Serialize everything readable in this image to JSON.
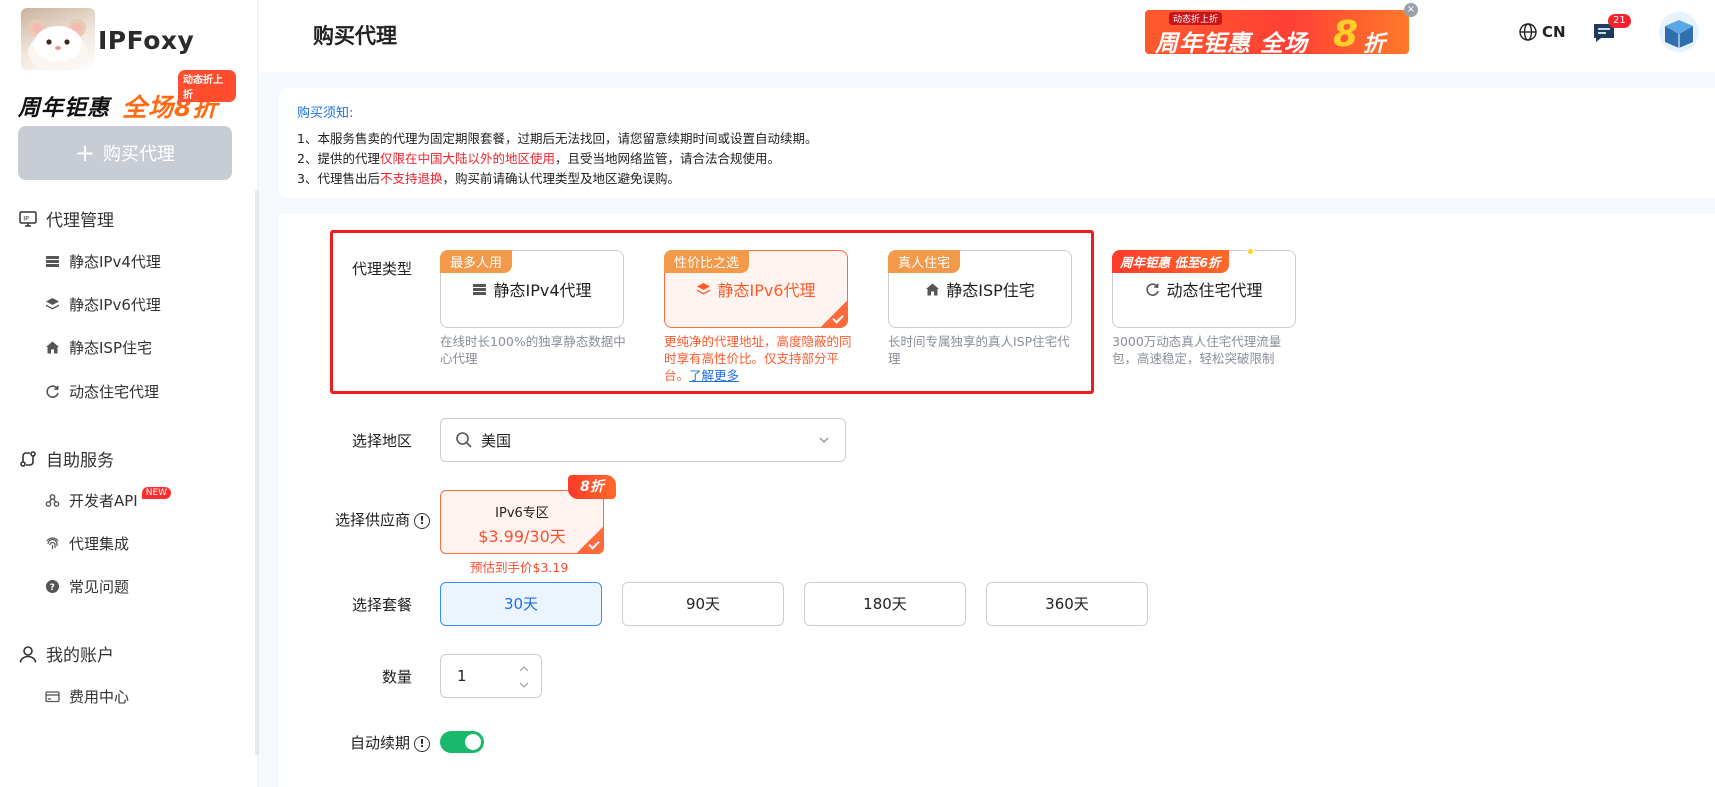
{
  "brand": {
    "name": "IPFoxy"
  },
  "sidebar_promo": {
    "text_black": "周年钜惠",
    "text_orange": "全场8折",
    "tag": "动态折上折"
  },
  "buy_button": {
    "label": "购买代理"
  },
  "nav": {
    "proxy_management": {
      "label": "代理管理",
      "items": [
        {
          "label": "静态IPv4代理",
          "icon": "server-icon"
        },
        {
          "label": "静态IPv6代理",
          "icon": "layers-icon"
        },
        {
          "label": "静态ISP住宅",
          "icon": "home-icon"
        },
        {
          "label": "动态住宅代理",
          "icon": "refresh-icon"
        }
      ]
    },
    "self_service": {
      "label": "自助服务",
      "items": [
        {
          "label": "开发者API",
          "badge": "NEW",
          "icon": "api-icon"
        },
        {
          "label": "代理集成",
          "icon": "fingerprint-icon"
        },
        {
          "label": "常见问题",
          "icon": "question-icon"
        }
      ]
    },
    "my_account": {
      "label": "我的账户",
      "items": [
        {
          "label": "费用中心",
          "icon": "card-icon"
        }
      ]
    }
  },
  "header": {
    "title": "购买代理",
    "banner": {
      "tag": "动态折上折",
      "text": "周年钜惠 全场",
      "number": "8",
      "suffix": "折"
    },
    "banner_close": "×",
    "language": "CN",
    "message_count": "21"
  },
  "notice": {
    "title": "购买须知:",
    "line1": "1、本服务售卖的代理为固定期限套餐，过期后无法找回，请您留意续期时间或设置自动续期。",
    "line2_prefix": "2、提供的代理",
    "line2_red": "仅限在中国大陆以外的地区使用",
    "line2_suffix": "，且受当地网络监管，请合法合规使用。",
    "line3_prefix": "3、代理售出后",
    "line3_red": "不支持退换",
    "line3_suffix": "，购买前请确认代理类型及地区避免误购。"
  },
  "form": {
    "proxy_type_label": "代理类型",
    "proxy_types": [
      {
        "tag": "最多人用",
        "label": "静态IPv4代理",
        "desc": "在线时长100%的独享静态数据中心代理"
      },
      {
        "tag": "性价比之选",
        "label": "静态IPv6代理",
        "desc": "更纯净的代理地址，高度隐蔽的同时享有高性价比。仅支持部分平台。",
        "learn_more": "了解更多",
        "selected": true
      },
      {
        "tag": "真人住宅",
        "label": "静态ISP住宅",
        "desc": "长时间专属独享的真人ISP住宅代理"
      },
      {
        "tag": "周年钜惠 低至6折",
        "label": "动态住宅代理",
        "desc": "3000万动态真人住宅代理流量包，高速稳定，轻松突破限制"
      }
    ],
    "region_label": "选择地区",
    "region_value": "美国",
    "supplier_label": "选择供应商",
    "supplier": {
      "name": "IPv6专区",
      "price": "$3.99/30天",
      "discount_tag": "8折",
      "estimate": "预估到手价$3.19"
    },
    "plan_label": "选择套餐",
    "plans": [
      "30天",
      "90天",
      "180天",
      "360天"
    ],
    "selected_plan": "30天",
    "quantity_label": "数量",
    "quantity_value": "1",
    "auto_renew_label": "自动续期",
    "auto_renew_on": true
  },
  "colors": {
    "accent_orange": "#ff5a2c",
    "accent_blue": "#1f6fe8",
    "toggle_green": "#19b86a",
    "highlight_red": "#f01c1c"
  }
}
